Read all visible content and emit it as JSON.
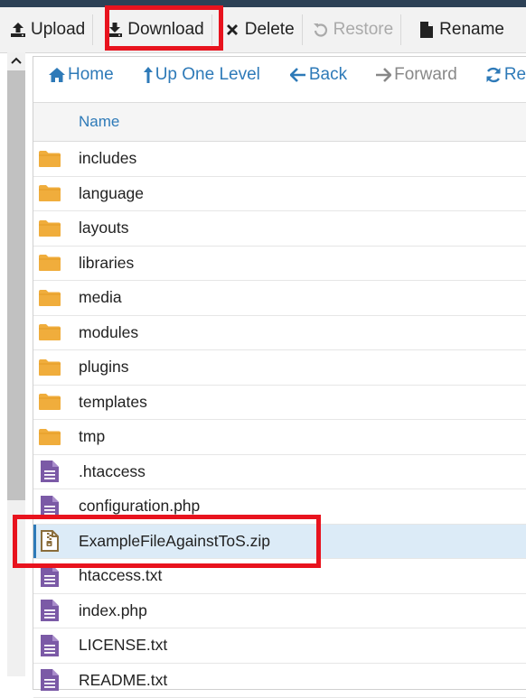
{
  "toolbar": {
    "upload": "Upload",
    "download": "Download",
    "delete": "Delete",
    "restore": "Restore",
    "rename": "Rename"
  },
  "nav": {
    "home": "Home",
    "up_one_level": "Up One Level",
    "back": "Back",
    "forward": "Forward",
    "reload": "Reload"
  },
  "table": {
    "header_name": "Name",
    "rows": [
      {
        "name": "includes",
        "kind": "folder-icon"
      },
      {
        "name": "language",
        "kind": "folder-icon"
      },
      {
        "name": "layouts",
        "kind": "folder-icon"
      },
      {
        "name": "libraries",
        "kind": "folder-icon"
      },
      {
        "name": "media",
        "kind": "folder-icon"
      },
      {
        "name": "modules",
        "kind": "folder-icon"
      },
      {
        "name": "plugins",
        "kind": "folder-icon"
      },
      {
        "name": "templates",
        "kind": "folder-icon"
      },
      {
        "name": "tmp",
        "kind": "folder-icon"
      },
      {
        "name": ".htaccess",
        "kind": "text-file-icon"
      },
      {
        "name": "configuration.php",
        "kind": "text-file-icon"
      },
      {
        "name": "ExampleFileAgainstToS.zip",
        "kind": "zip-file-icon",
        "selected": true
      },
      {
        "name": "htaccess.txt",
        "kind": "text-file-icon"
      },
      {
        "name": "index.php",
        "kind": "text-file-icon"
      },
      {
        "name": "LICENSE.txt",
        "kind": "text-file-icon"
      },
      {
        "name": "README.txt",
        "kind": "text-file-icon"
      }
    ]
  },
  "colors": {
    "accent": "#2e7ab8",
    "folder": "#f0ad3c",
    "text_file": "#7b5aa6",
    "zip_file": "#8a6d3b",
    "highlight": "#e8131e",
    "selected_row": "#dcebf7"
  }
}
